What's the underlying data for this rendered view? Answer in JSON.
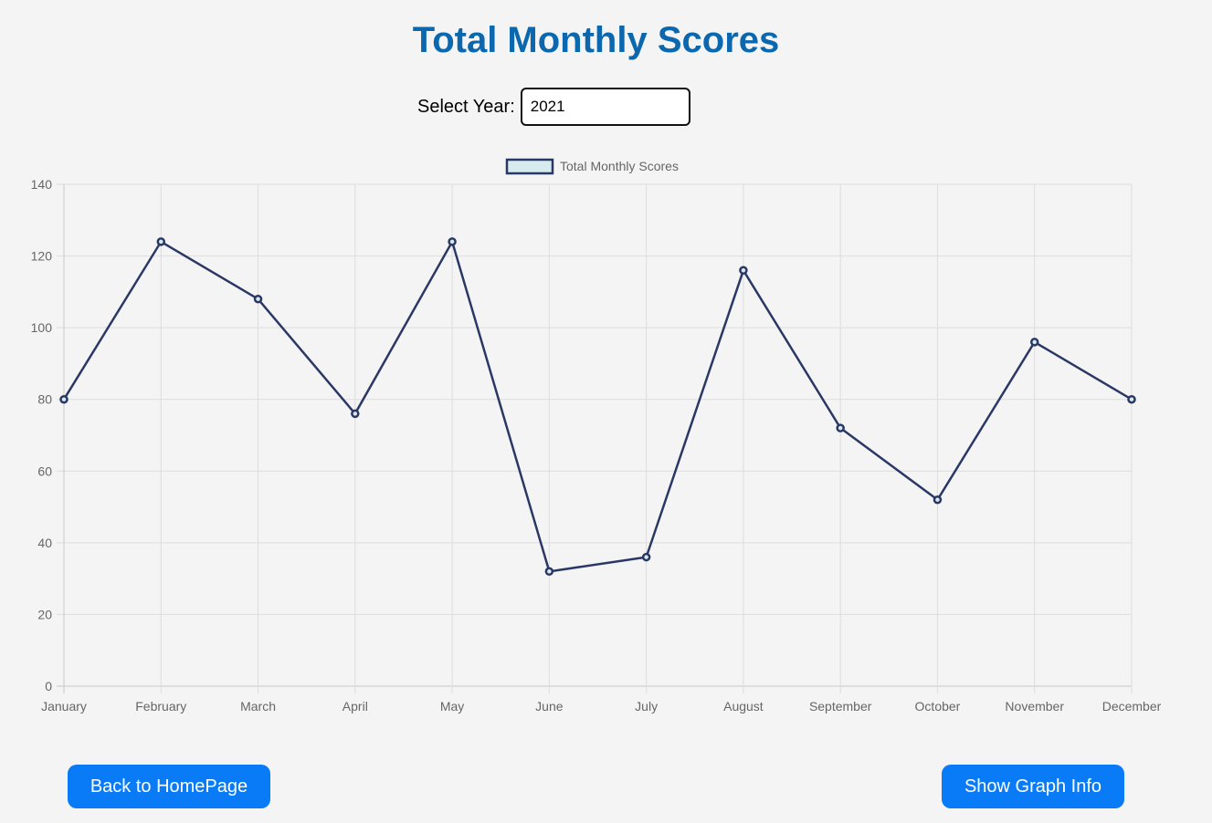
{
  "page": {
    "title": "Total Monthly Scores"
  },
  "year_selector": {
    "label": "Select Year:",
    "value": "2021"
  },
  "buttons": {
    "back_label": "Back to HomePage",
    "info_label": "Show Graph Info"
  },
  "colors": {
    "title": "#0b67ae",
    "line": "#2b3866",
    "legend_fill": "#d5ebee",
    "button": "#0a7bf6",
    "grid": "#dddddd",
    "tick_text": "#666666"
  },
  "chart_data": {
    "type": "line",
    "legend": "Total Monthly Scores",
    "legend_position": "top",
    "grid": true,
    "categories": [
      "January",
      "February",
      "March",
      "April",
      "May",
      "June",
      "July",
      "August",
      "September",
      "October",
      "November",
      "December"
    ],
    "series": [
      {
        "name": "Total Monthly Scores",
        "values": [
          80,
          124,
          108,
          76,
          124,
          32,
          36,
          116,
          72,
          52,
          96,
          80
        ]
      }
    ],
    "ylim": [
      0,
      140
    ],
    "yticks": [
      0,
      20,
      40,
      60,
      80,
      100,
      120,
      140
    ]
  }
}
